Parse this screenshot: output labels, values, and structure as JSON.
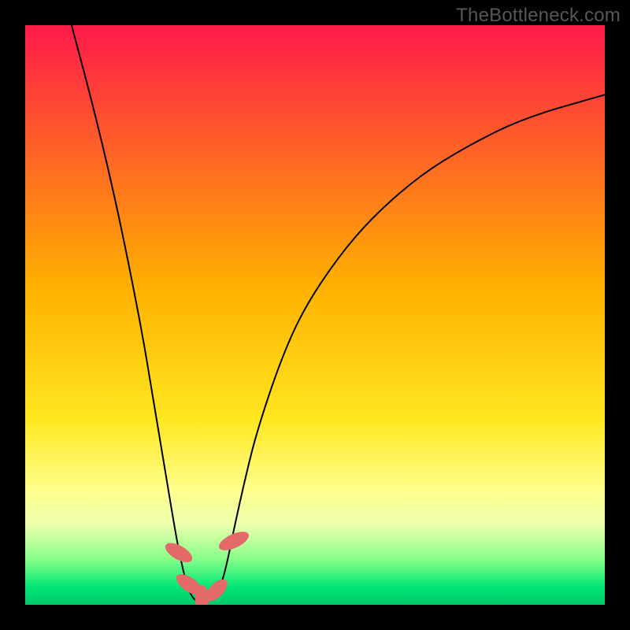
{
  "watermark": "TheBottleneck.com",
  "chart_data": {
    "type": "line",
    "title": "",
    "xlabel": "",
    "ylabel": "",
    "xlim": [
      0,
      100
    ],
    "ylim": [
      0,
      100
    ],
    "grid": false,
    "legend": false,
    "background_gradient": {
      "stops": [
        {
          "offset": 0.0,
          "color": "#ff1a4a"
        },
        {
          "offset": 0.45,
          "color": "#ffb000"
        },
        {
          "offset": 0.68,
          "color": "#ffe720"
        },
        {
          "offset": 0.8,
          "color": "#ffff8a"
        },
        {
          "offset": 0.86,
          "color": "#eeffae"
        },
        {
          "offset": 0.92,
          "color": "#8aff8a"
        },
        {
          "offset": 0.97,
          "color": "#00e676"
        },
        {
          "offset": 1.0,
          "color": "#00c96b"
        }
      ]
    },
    "series": [
      {
        "name": "bottleneck-curve",
        "x": [
          8,
          12,
          16,
          20,
          22,
          24,
          26,
          27,
          28,
          29,
          30,
          31,
          32,
          33,
          34,
          35,
          36,
          38,
          40,
          44,
          48,
          54,
          60,
          68,
          76,
          86,
          100
        ],
        "y": [
          100,
          85,
          68,
          48,
          36,
          24,
          12,
          7,
          3,
          1,
          0.5,
          0.5,
          1,
          2,
          4,
          8,
          13,
          22,
          30,
          42,
          51,
          60,
          67,
          74,
          79,
          84,
          88
        ]
      }
    ],
    "markers": [
      {
        "x": 26.5,
        "y": 9.0,
        "color": "#e46a6a",
        "rx": 1.2,
        "ry": 2.6,
        "angle": -60
      },
      {
        "x": 28.3,
        "y": 3.5,
        "color": "#e46a6a",
        "rx": 1.2,
        "ry": 2.6,
        "angle": -55
      },
      {
        "x": 30.5,
        "y": 1.0,
        "color": "#e46a6a",
        "rx": 1.2,
        "ry": 2.4,
        "angle": 0
      },
      {
        "x": 33.0,
        "y": 2.5,
        "color": "#e46a6a",
        "rx": 1.2,
        "ry": 2.4,
        "angle": 45
      },
      {
        "x": 36.0,
        "y": 11.0,
        "color": "#e46a6a",
        "rx": 1.2,
        "ry": 2.8,
        "angle": 65
      }
    ]
  }
}
